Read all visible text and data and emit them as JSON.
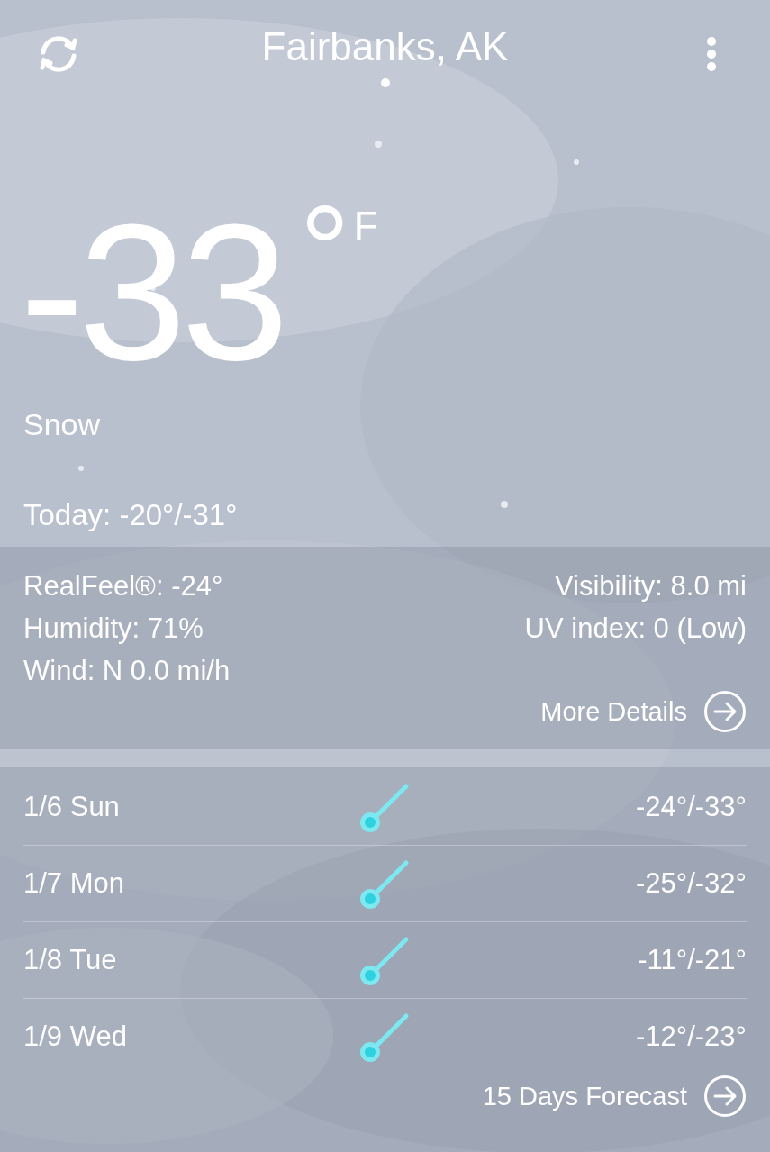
{
  "header": {
    "title": "Fairbanks, AK",
    "pages": [
      {
        "selected": true
      }
    ]
  },
  "current": {
    "temperature": "-33",
    "degree": "°",
    "unit": "F",
    "condition": "Snow",
    "today": "Today: -20°/-31°"
  },
  "details": {
    "left": [
      "RealFeel®: -24°",
      "Humidity: 71%",
      "Wind: N 0.0 mi/h"
    ],
    "right": [
      "Visibility: 8.0 mi",
      "UV index: 0 (Low)"
    ],
    "link": "More Details"
  },
  "forecast": {
    "days": [
      {
        "date": "1/6 Sun",
        "temps": "-24°/-33°"
      },
      {
        "date": "1/7 Mon",
        "temps": "-25°/-32°"
      },
      {
        "date": "1/8 Tue",
        "temps": "-11°/-21°"
      },
      {
        "date": "1/9 Wed",
        "temps": "-12°/-23°"
      }
    ],
    "link": "15 Days Forecast"
  }
}
